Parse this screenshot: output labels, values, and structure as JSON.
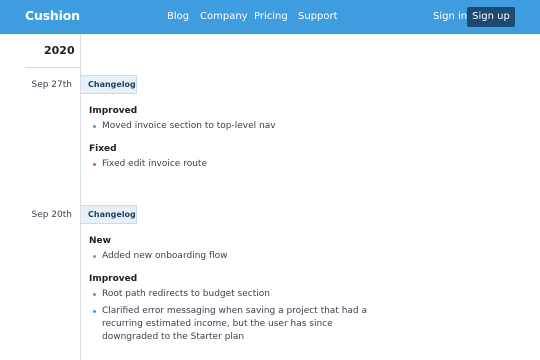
{
  "nav": {
    "logo": "Cushion",
    "links": [
      "Blog",
      "Company",
      "Pricing",
      "Support"
    ],
    "sign_in": "Sign in",
    "sign_up": "Sign up"
  },
  "timeline": {
    "year": "2020",
    "entries": [
      {
        "date": "Sep 27th",
        "badge": "Changelog",
        "sections": [
          {
            "heading": "Improved",
            "type": "improved",
            "items": [
              "Moved invoice section to top-level nav"
            ]
          },
          {
            "heading": "Fixed",
            "type": "fixed",
            "items": [
              "Fixed edit invoice route"
            ]
          }
        ]
      },
      {
        "date": "Sep 20th",
        "badge": "Changelog",
        "sections": [
          {
            "heading": "New",
            "type": "new",
            "items": [
              "Added new onboarding flow"
            ]
          },
          {
            "heading": "Improved",
            "type": "improved",
            "items": [
              "Root path redirects to budget section",
              "Clarified error messaging when saving a project that had a recurring estimated income, but the user has since downgraded to the Starter plan"
            ]
          }
        ]
      }
    ]
  },
  "colors": {
    "nav_bg": "#3f9ddf",
    "signup_bg": "#1c4a72",
    "bullet_improved": "#3f9ddf",
    "bullet_fixed": "#d2527a",
    "bullet_new": "#4fba6f"
  }
}
